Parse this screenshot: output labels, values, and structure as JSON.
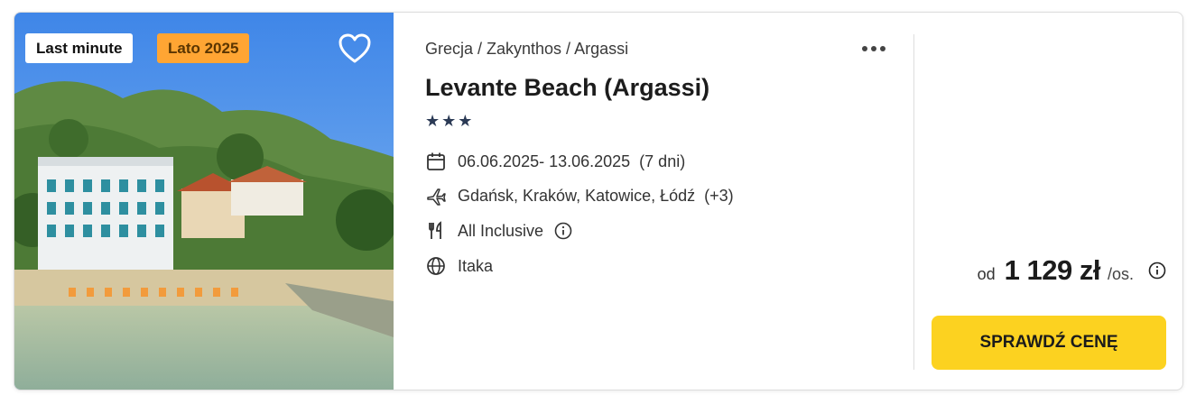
{
  "badges": {
    "last_minute": "Last minute",
    "season": "Lato 2025"
  },
  "offer": {
    "breadcrumb": "Grecja / Zakynthos / Argassi",
    "title": "Levante Beach (Argassi)",
    "stars": "★★★",
    "dates": "06.06.2025- 13.06.2025",
    "duration": "(7 dni)",
    "departures": "Gdańsk, Kraków, Katowice, Łódź",
    "departures_more": "(+3)",
    "board": "All Inclusive",
    "operator": "Itaka"
  },
  "price": {
    "from_label": "od",
    "amount": "1 129 zł",
    "per_label": "/os."
  },
  "cta": {
    "label": "SPRAWDŹ CENĘ"
  },
  "colors": {
    "accent_yellow": "#fcd220",
    "season_badge": "#ffa533",
    "star_navy": "#2b3a55"
  },
  "icons": [
    "heart-icon",
    "more-dots-icon",
    "calendar-icon",
    "plane-icon",
    "cutlery-icon",
    "info-icon",
    "globe-icon"
  ]
}
